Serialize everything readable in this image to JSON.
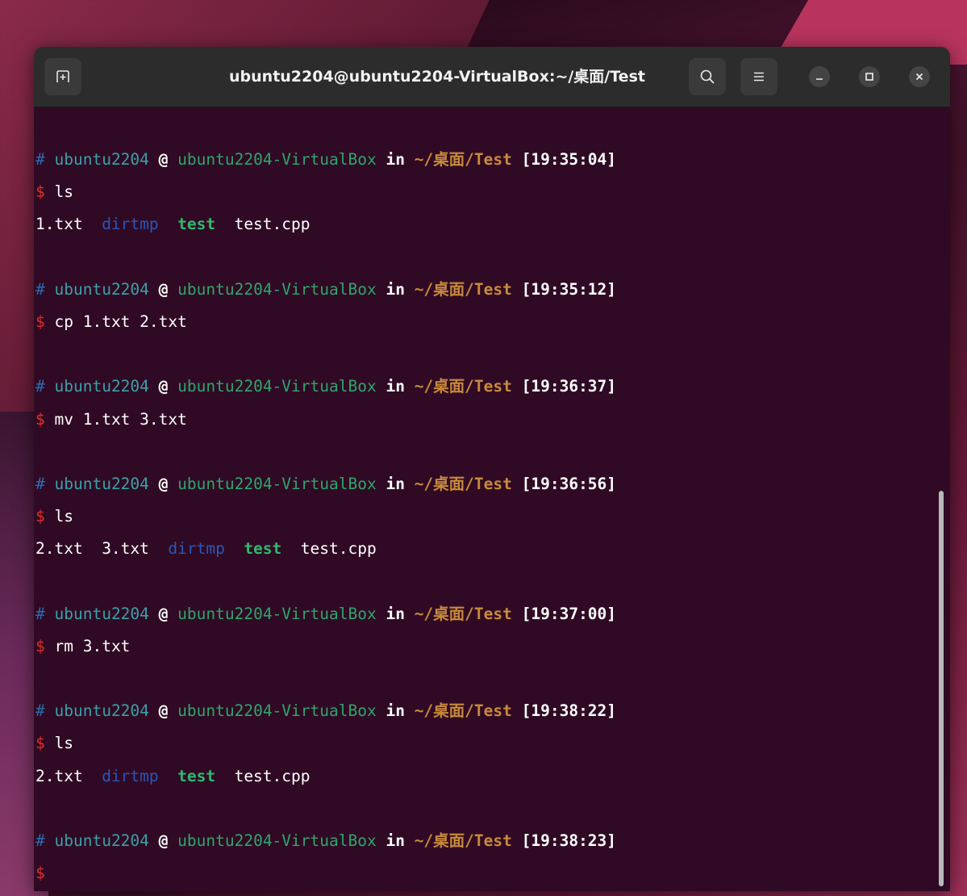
{
  "window": {
    "title": "ubuntu2204@ubuntu2204-VirtualBox:~/桌面/Test"
  },
  "icons": {
    "new_tab": "new-tab-icon",
    "search": "search-icon",
    "menu": "hamburger-menu-icon",
    "minimize": "minimize-icon",
    "maximize": "maximize-icon",
    "close": "close-icon"
  },
  "prompt": {
    "hash": "#",
    "user": "ubuntu2204",
    "at": "@",
    "host": "ubuntu2204-VirtualBox",
    "in": "in",
    "path": "~/桌面/Test",
    "dollar": "$"
  },
  "blocks": [
    {
      "time": "[19:35:04]",
      "command": "ls",
      "output": [
        {
          "name": "1.txt",
          "kind": "file"
        },
        {
          "name": "dirtmp",
          "kind": "dir"
        },
        {
          "name": "test",
          "kind": "exec"
        },
        {
          "name": "test.cpp",
          "kind": "file"
        }
      ]
    },
    {
      "time": "[19:35:12]",
      "command": "cp 1.txt 2.txt",
      "output": []
    },
    {
      "time": "[19:36:37]",
      "command": "mv 1.txt 3.txt",
      "output": []
    },
    {
      "time": "[19:36:56]",
      "command": "ls",
      "output": [
        {
          "name": "2.txt",
          "kind": "file"
        },
        {
          "name": "3.txt",
          "kind": "file"
        },
        {
          "name": "dirtmp",
          "kind": "dir"
        },
        {
          "name": "test",
          "kind": "exec"
        },
        {
          "name": "test.cpp",
          "kind": "file"
        }
      ]
    },
    {
      "time": "[19:37:00]",
      "command": "rm 3.txt",
      "output": []
    },
    {
      "time": "[19:38:22]",
      "command": "ls",
      "output": [
        {
          "name": "2.txt",
          "kind": "file"
        },
        {
          "name": "dirtmp",
          "kind": "dir"
        },
        {
          "name": "test",
          "kind": "exec"
        },
        {
          "name": "test.cpp",
          "kind": "file"
        }
      ]
    },
    {
      "time": "[19:38:23]",
      "command": "",
      "output": []
    }
  ],
  "colors": {
    "terminal_bg": "#300a24",
    "header_bg": "#2c2c2c",
    "user": "#3aa0a8",
    "host": "#2ea56c",
    "path": "#c88a3a",
    "dollar": "#e0302a",
    "dir": "#2a55b8",
    "exec": "#2eb86c"
  }
}
